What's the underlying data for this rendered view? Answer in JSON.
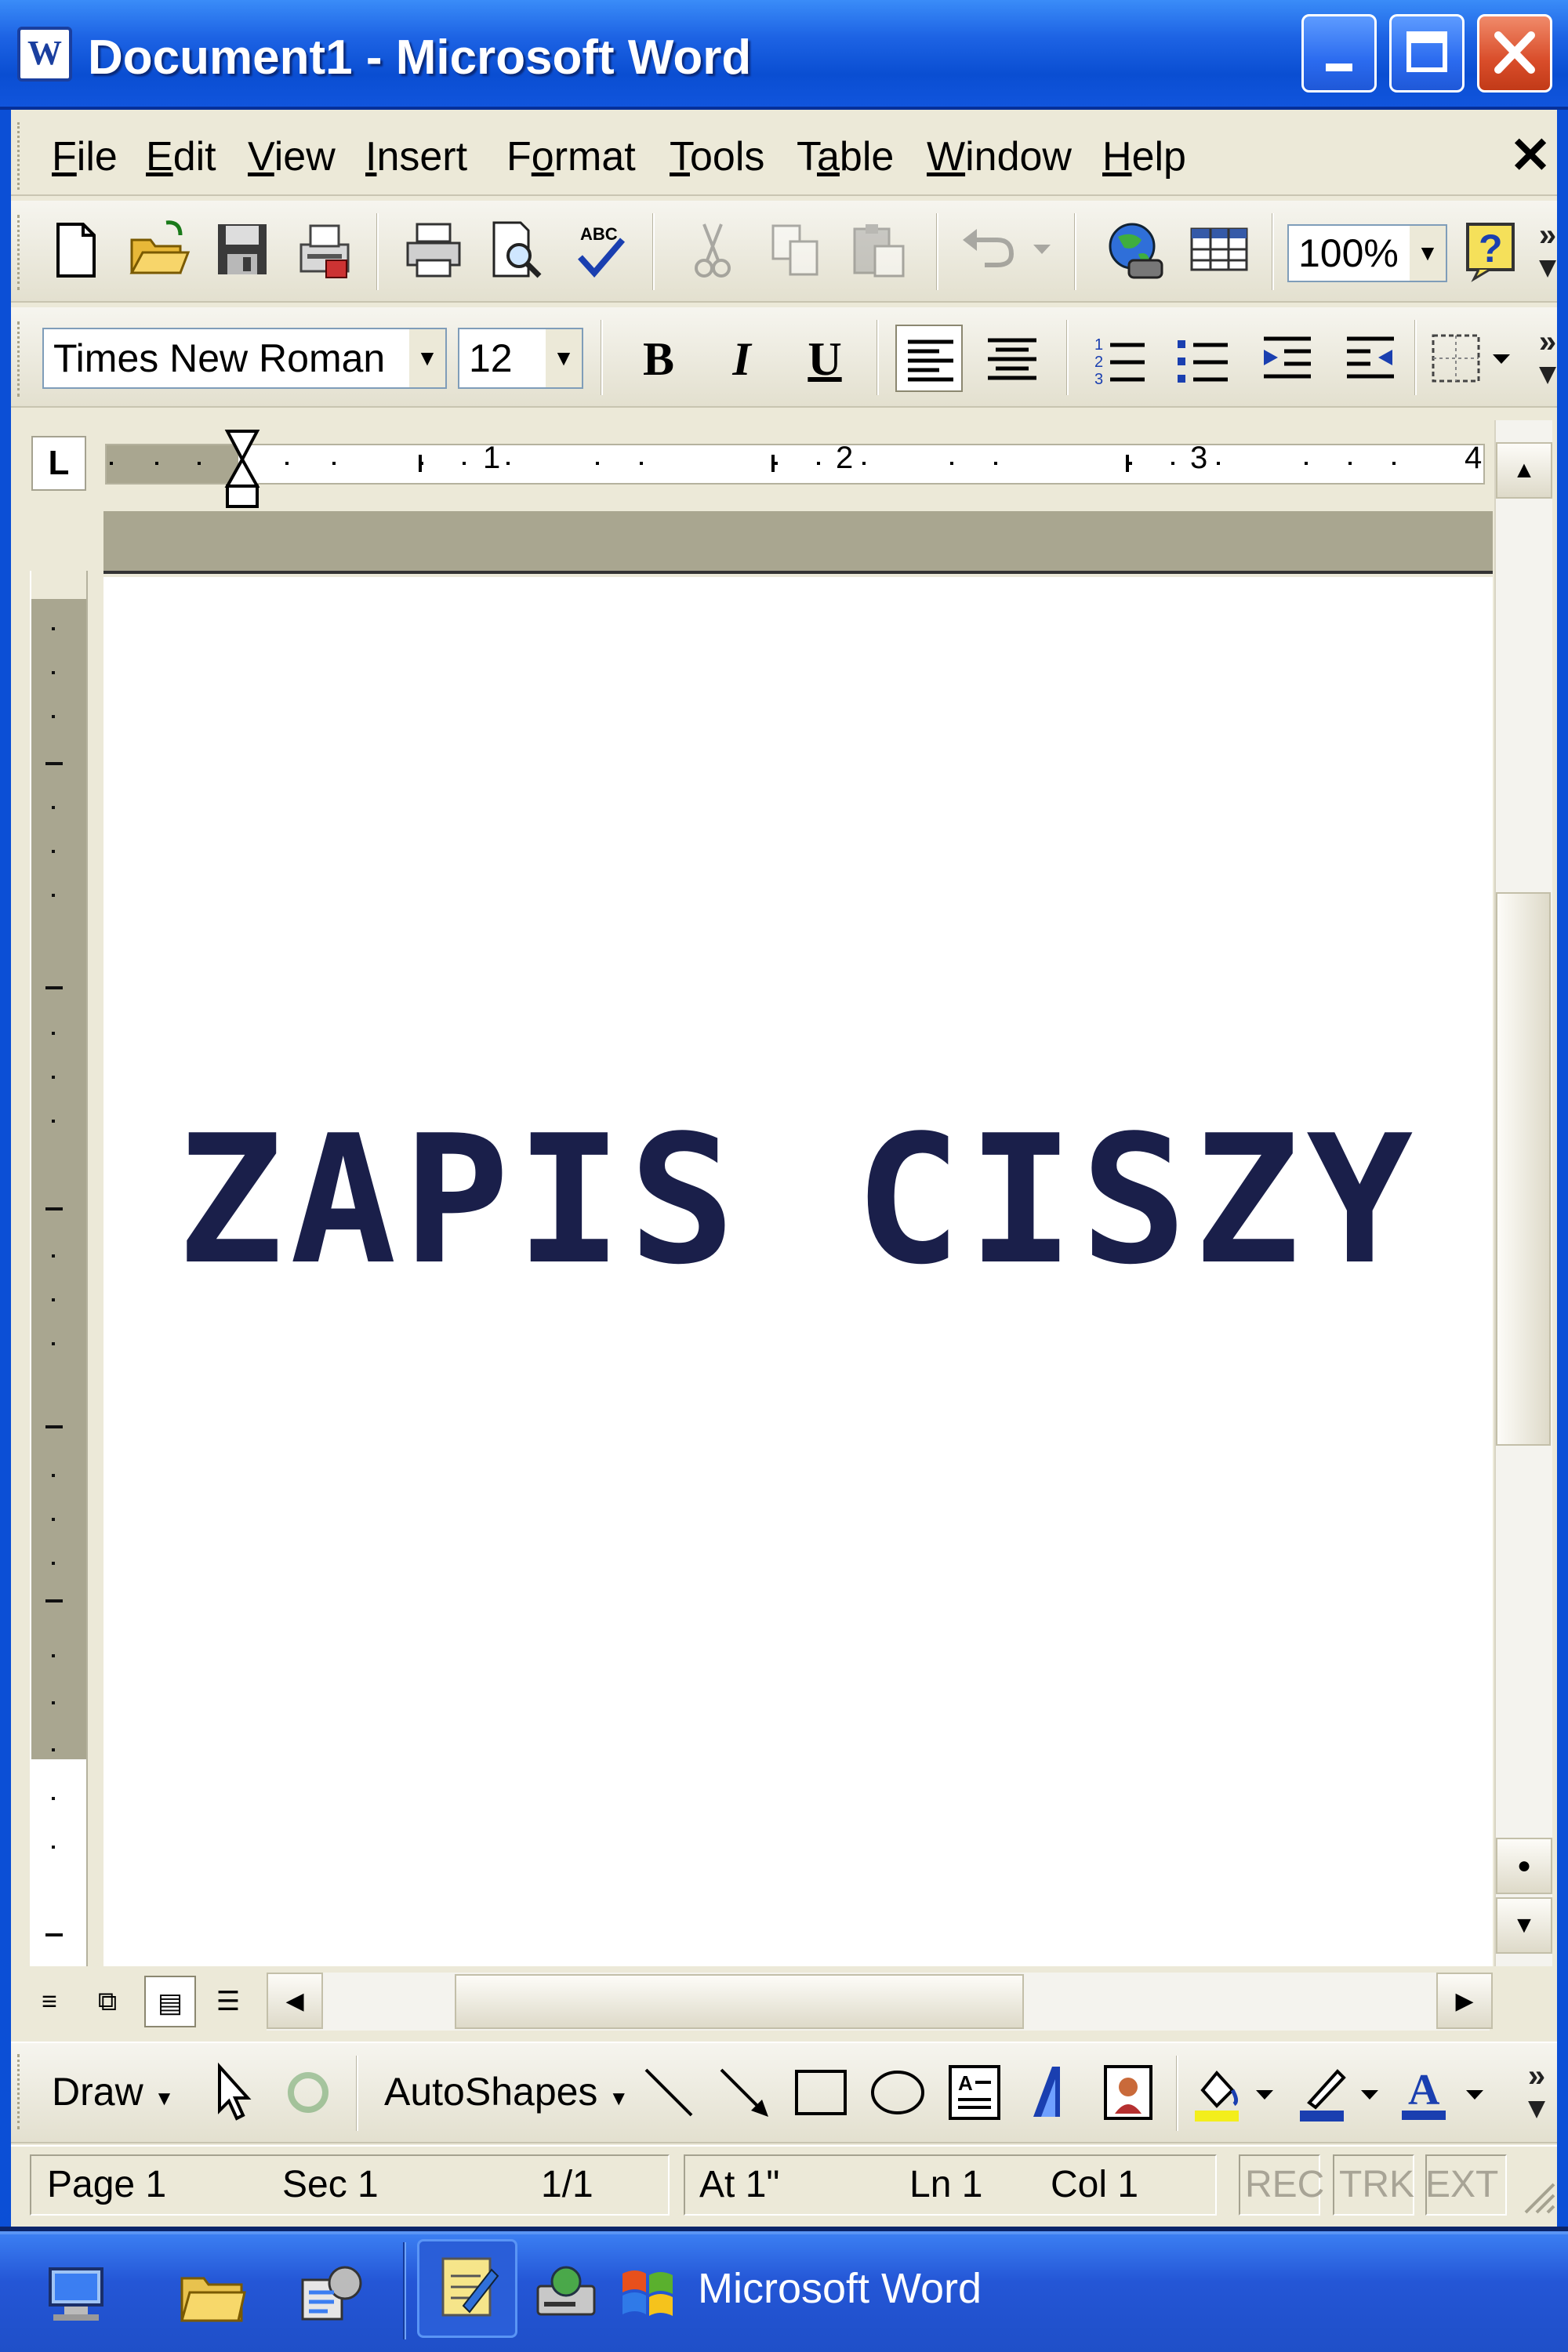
{
  "window": {
    "title": "Document1 - Microsoft Word",
    "app_icon": "word-icon",
    "caption_buttons": [
      "minimize-icon",
      "maximize-icon",
      "close-icon"
    ]
  },
  "menu": {
    "items": [
      {
        "label": "File",
        "accel": "F"
      },
      {
        "label": "Edit",
        "accel": "E"
      },
      {
        "label": "View",
        "accel": "V"
      },
      {
        "label": "Insert",
        "accel": "I"
      },
      {
        "label": "Format",
        "accel": "o"
      },
      {
        "label": "Tools",
        "accel": "T"
      },
      {
        "label": "Table",
        "accel": "a"
      },
      {
        "label": "Window",
        "accel": "W"
      },
      {
        "label": "Help",
        "accel": "H"
      }
    ],
    "close_glyph": "✕"
  },
  "standard_toolbar": {
    "zoom": "100%",
    "icons": [
      "new-document-icon",
      "open-folder-icon",
      "save-icon",
      "permission-icon",
      "print-icon",
      "print-preview-icon",
      "spelling-icon",
      "cut-icon",
      "copy-icon",
      "paste-icon",
      "undo-icon",
      "web-globe-icon",
      "insert-table-icon",
      "help-icon"
    ]
  },
  "formatting_toolbar": {
    "font_name": "Times New Roman",
    "font_size": "12",
    "bold": "B",
    "italic": "I",
    "underline": "U"
  },
  "ruler": {
    "tab_type": "L",
    "numbers": [
      "1",
      "2",
      "3",
      "4"
    ]
  },
  "document": {
    "text": "ZAPIS CISZY"
  },
  "drawing_toolbar": {
    "draw": "Draw",
    "autoshapes": "AutoShapes"
  },
  "statusbar": {
    "page": "Page  1",
    "sec": "Sec  1",
    "pages": "1/1",
    "at": "At  1\"",
    "ln": "Ln  1",
    "col": "Col  1",
    "rec": "REC",
    "trk": "TRK",
    "ext": "EXT"
  },
  "taskbar": {
    "task_label": "Microsoft Word"
  }
}
